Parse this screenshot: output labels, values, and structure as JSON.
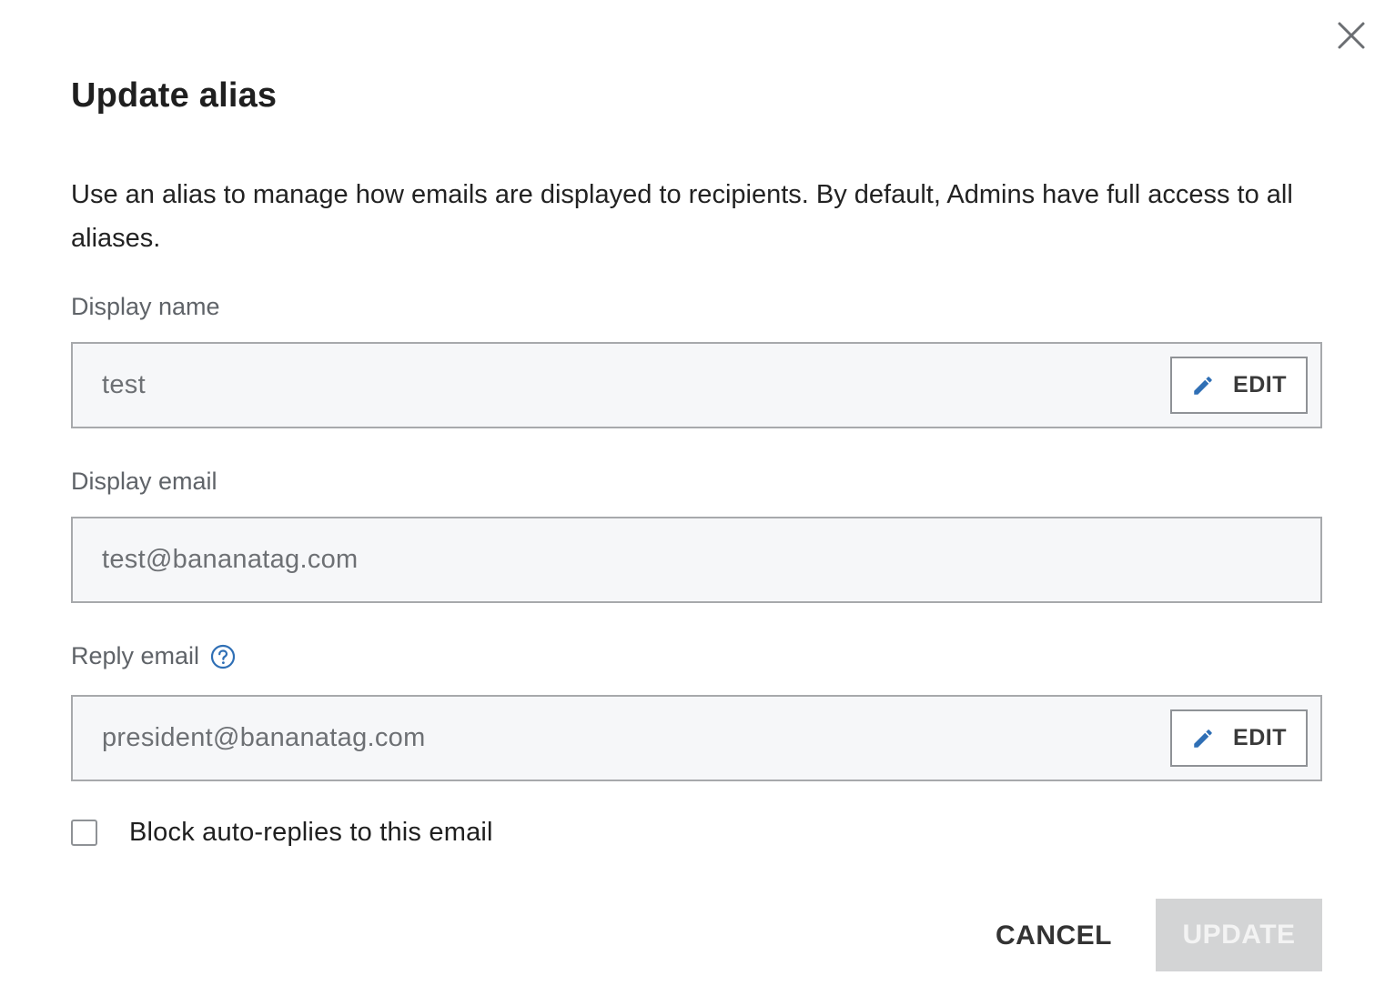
{
  "dialog": {
    "title": "Update alias",
    "description": "Use an alias to manage how emails are displayed to recipients. By default, Admins have full access to all aliases.",
    "close_icon": "close-icon"
  },
  "fields": {
    "display_name": {
      "label": "Display name",
      "value": "test",
      "edit_label": "EDIT"
    },
    "display_email": {
      "label": "Display email",
      "value": "test@bananatag.com"
    },
    "reply_email": {
      "label": "Reply email",
      "help_icon": "help-icon",
      "value": "president@bananatag.com",
      "edit_label": "EDIT"
    }
  },
  "block_auto_replies": {
    "label": "Block auto-replies to this email",
    "checked": false
  },
  "actions": {
    "cancel_label": "CANCEL",
    "update_label": "UPDATE",
    "update_disabled": true
  },
  "colors": {
    "accent": "#2f6fb5",
    "field_background": "#f6f7f9",
    "field_border": "#a7a9ac",
    "disabled_button": "#d3d4d5"
  }
}
